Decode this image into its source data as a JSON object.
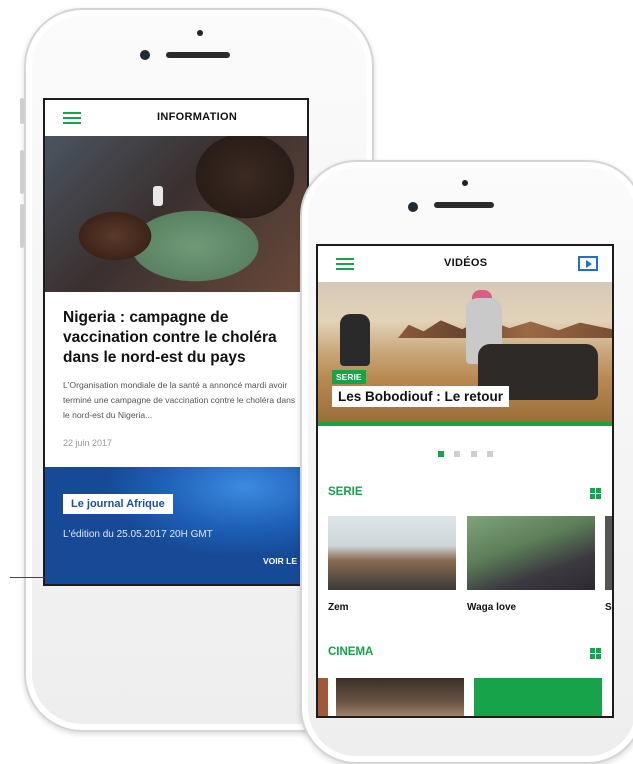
{
  "left_screen": {
    "header_title": "INFORMATION",
    "article": {
      "title": "Nigeria : campagne de vaccination contre le choléra dans le nord-est du pays",
      "summary": "L'Organisation mondiale de la santé a annoncé mardi avoir terminé une campagne de vaccination contre le choléra dans le nord-est du Nigeria...",
      "date": "22 juin 2017"
    },
    "journal": {
      "button_label": "Le journal Afrique",
      "subtitle": "L'édition du 25.05.2017 20H GMT",
      "more_label": "VOIR LE"
    }
  },
  "right_screen": {
    "header_title": "VIDÉOS",
    "hero": {
      "badge": "SERIE",
      "title": "Les Bobodiouf : Le retour"
    },
    "carousel_active": 1,
    "sections": [
      {
        "label": "SERIE",
        "items": [
          {
            "title": "Zem"
          },
          {
            "title": "Waga love"
          },
          {
            "title": "S"
          }
        ]
      },
      {
        "label": "CINEMA",
        "items": []
      }
    ]
  },
  "colors": {
    "accent_green": "#16a34a",
    "accent_blue": "#1d6fd3",
    "journal_blue": "#1e5fb8"
  },
  "icons": [
    "hamburger-menu-icon",
    "play-video-icon",
    "grid-view-icon"
  ]
}
